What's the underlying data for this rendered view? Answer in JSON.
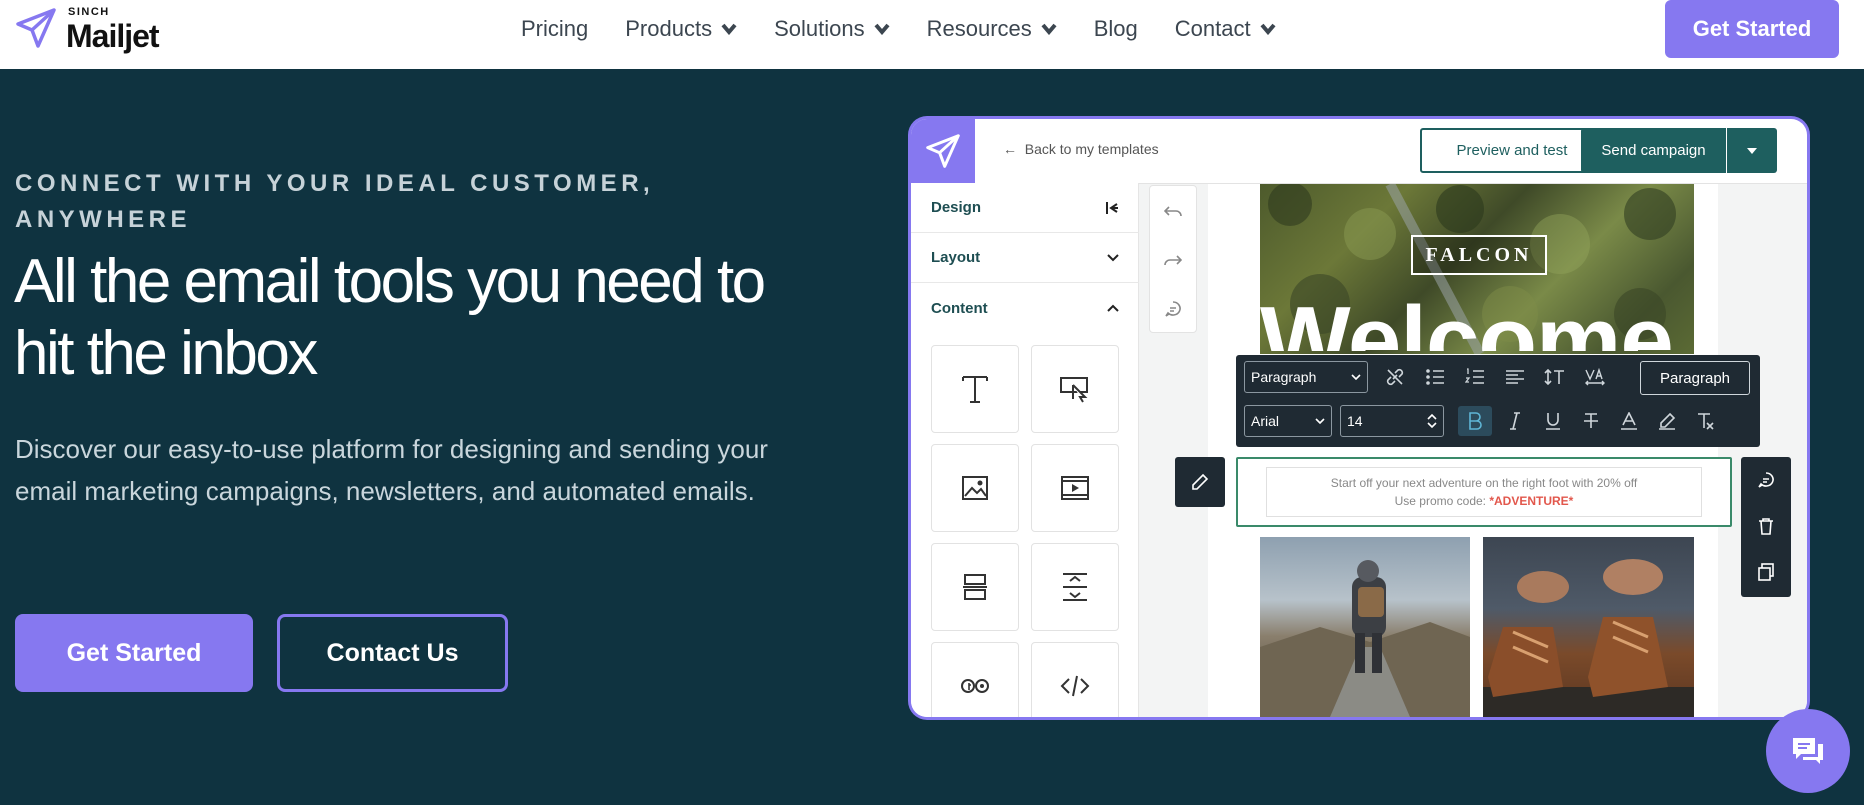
{
  "brand": {
    "sinch_label": "SINCH",
    "name": "Mailjet",
    "accent": "#8678f0",
    "background": "#0f3340"
  },
  "nav": {
    "items": [
      {
        "label": "Pricing",
        "has_dropdown": false
      },
      {
        "label": "Products",
        "has_dropdown": true
      },
      {
        "label": "Solutions",
        "has_dropdown": true
      },
      {
        "label": "Resources",
        "has_dropdown": true
      },
      {
        "label": "Blog",
        "has_dropdown": false
      },
      {
        "label": "Contact",
        "has_dropdown": true
      }
    ],
    "cta_label": "Get Started"
  },
  "hero": {
    "eyebrow": "CONNECT WITH YOUR IDEAL CUSTOMER, ANYWHERE",
    "headline": "All the email tools you need to hit the inbox",
    "description": "Discover our easy-to-use platform for designing and sending your email marketing campaigns, newsletters, and automated emails.",
    "primary_button": "Get Started",
    "secondary_button": "Contact Us"
  },
  "editor": {
    "back_link": "Back to my templates",
    "preview_button": "Preview and test",
    "send_button": "Send campaign",
    "sidebar": {
      "sections": [
        {
          "label": "Design"
        },
        {
          "label": "Layout"
        },
        {
          "label": "Content"
        }
      ],
      "content_blocks": [
        "text-icon",
        "button-icon",
        "image-icon",
        "video-icon",
        "divider-icon",
        "spacer-icon",
        "social-icon",
        "html-icon"
      ]
    },
    "email": {
      "brand_sign": "FALCON",
      "headline": "Welcome",
      "promo_line1": "Start off your next adventure on the right foot with 20% off",
      "promo_line2_prefix": "Use promo code: ",
      "promo_code": "*ADVENTURE*"
    },
    "toolbar": {
      "block_type": "Paragraph",
      "font": "Arial",
      "font_size": "14",
      "style_button": "Paragraph"
    }
  }
}
